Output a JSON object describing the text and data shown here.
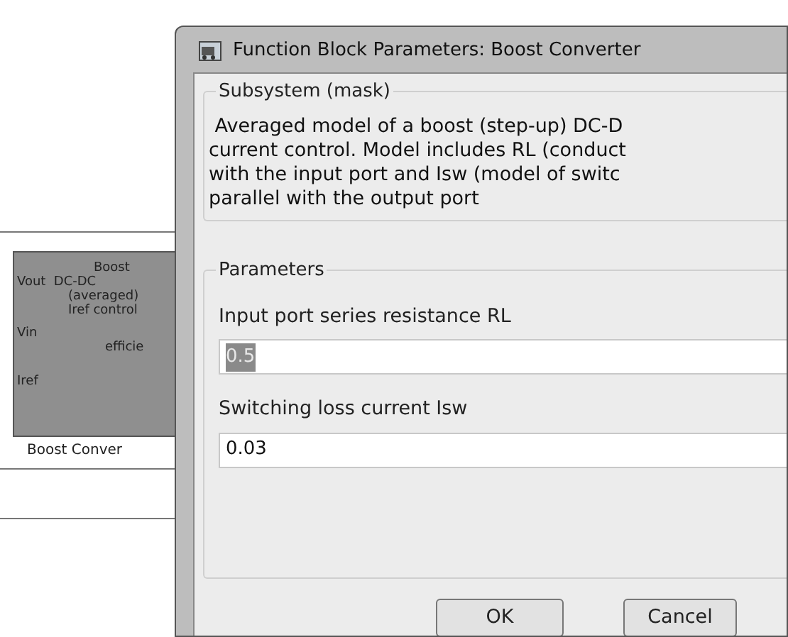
{
  "block": {
    "lines": [
      "Boost",
      "Vout  DC-DC",
      "(averaged)",
      "Iref control",
      "Vin",
      "efficie",
      "Iref"
    ],
    "label": "Boost Conver"
  },
  "window": {
    "title": "Function Block Parameters: Boost Converter"
  },
  "mask": {
    "title": "Subsystem (mask)",
    "description": [
      " Averaged model of a boost (step-up) DC-D",
      "current control. Model includes RL (conduct",
      "with the input port and Isw (model of switc",
      "parallel with the output port"
    ]
  },
  "parameters": {
    "title": "Parameters",
    "fields": [
      {
        "label": "Input port series resistance RL",
        "value": "0.5",
        "selected": true
      },
      {
        "label": "Switching loss current Isw",
        "value": "0.03",
        "selected": false
      }
    ]
  },
  "buttons": [
    "OK",
    "Cancel"
  ]
}
